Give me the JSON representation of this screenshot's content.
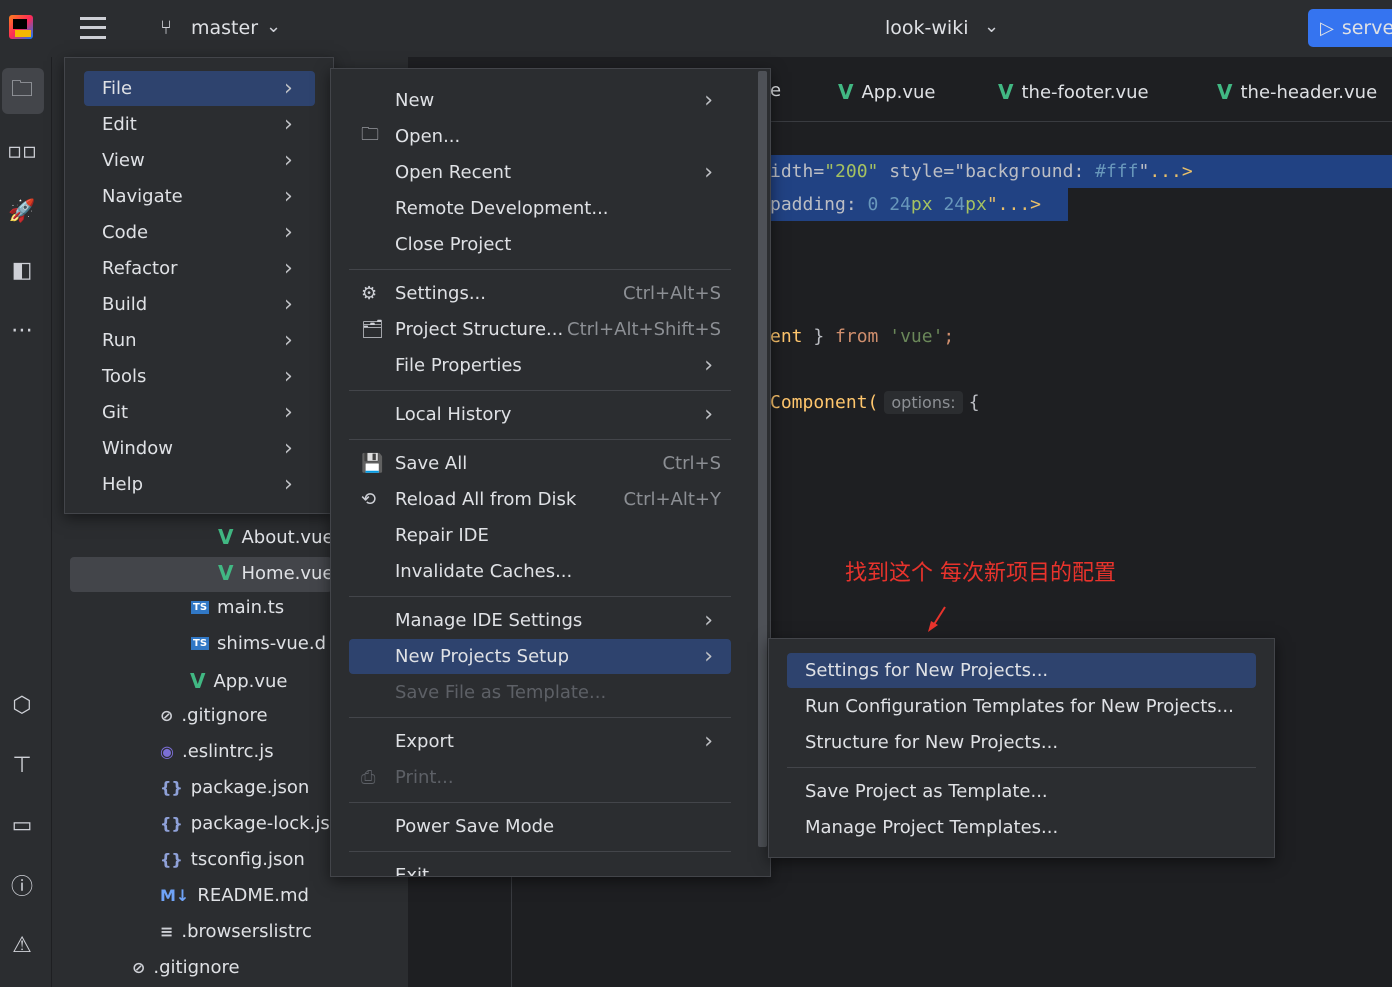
{
  "topbar": {
    "branch": "master",
    "project": "look-wiki",
    "run_label": "serve"
  },
  "tabs": [
    "e",
    "App.vue",
    "the-footer.vue",
    "the-header.vue"
  ],
  "code": {
    "line1": [
      {
        "t": "idth=",
        "c": "#bcbec4"
      },
      {
        "t": "\"200\"",
        "c": "#a5c261"
      },
      {
        "t": " style=",
        "c": "#bcbec4"
      },
      {
        "t": "\"background: ",
        "c": "#bcbec4"
      },
      {
        "t": "#fff",
        "c": "#6897bb"
      },
      {
        "t": "\"",
        "c": "#bcbec4"
      },
      {
        "t": "...>",
        "c": "#e8bf6a"
      }
    ],
    "line2": [
      {
        "t": "padding: ",
        "c": "#bcbec4"
      },
      {
        "t": "0 ",
        "c": "#6897bb"
      },
      {
        "t": "24",
        "c": "#6897bb"
      },
      {
        "t": "px ",
        "c": "#a5c261"
      },
      {
        "t": "24",
        "c": "#6897bb"
      },
      {
        "t": "px",
        "c": "#a5c261"
      },
      {
        "t": "\"...>",
        "c": "#e8bf6a"
      }
    ],
    "line3": [
      {
        "t": "ent",
        "c": "#ffc66d"
      },
      {
        "t": " } ",
        "c": "#bcbec4"
      },
      {
        "t": "from",
        "c": "#cf8e6d"
      },
      {
        "t": " 'vue'",
        "c": "#6a8759"
      },
      {
        "t": ";",
        "c": "#cf8e6d"
      }
    ],
    "line4_pre": "Component(",
    "line4_hint": "options:",
    "line4_post": "{"
  },
  "main_menu": [
    {
      "label": "File",
      "selected": true
    },
    {
      "label": "Edit"
    },
    {
      "label": "View"
    },
    {
      "label": "Navigate"
    },
    {
      "label": "Code"
    },
    {
      "label": "Refactor"
    },
    {
      "label": "Build"
    },
    {
      "label": "Run"
    },
    {
      "label": "Tools"
    },
    {
      "label": "Git"
    },
    {
      "label": "Window"
    },
    {
      "label": "Help"
    }
  ],
  "file_menu": [
    {
      "label": "New",
      "submenu": true
    },
    {
      "label": "Open...",
      "icon": "folder-icon"
    },
    {
      "label": "Open Recent",
      "submenu": true
    },
    {
      "label": "Remote Development..."
    },
    {
      "label": "Close Project"
    },
    {
      "sep": true
    },
    {
      "label": "Settings...",
      "icon": "gear-icon",
      "shortcut": "Ctrl+Alt+S"
    },
    {
      "label": "Project Structure...",
      "icon": "project-structure-icon",
      "shortcut": "Ctrl+Alt+Shift+S"
    },
    {
      "label": "File Properties",
      "submenu": true
    },
    {
      "sep": true
    },
    {
      "label": "Local History",
      "submenu": true
    },
    {
      "sep": true
    },
    {
      "label": "Save All",
      "icon": "save-icon",
      "shortcut": "Ctrl+S"
    },
    {
      "label": "Reload All from Disk",
      "icon": "reload-icon",
      "shortcut": "Ctrl+Alt+Y"
    },
    {
      "label": "Repair IDE"
    },
    {
      "label": "Invalidate Caches..."
    },
    {
      "sep": true
    },
    {
      "label": "Manage IDE Settings",
      "submenu": true
    },
    {
      "label": "New Projects Setup",
      "submenu": true,
      "selected": true
    },
    {
      "label": "Save File as Template...",
      "disabled": true
    },
    {
      "sep": true
    },
    {
      "label": "Export",
      "submenu": true
    },
    {
      "label": "Print...",
      "icon": "print-icon",
      "disabled": true
    },
    {
      "sep": true
    },
    {
      "label": "Power Save Mode"
    },
    {
      "sep": true
    },
    {
      "label": "Exit"
    }
  ],
  "sub_menu": [
    {
      "label": "Settings for New Projects...",
      "selected": true
    },
    {
      "label": "Run Configuration Templates for New Projects..."
    },
    {
      "label": "Structure for New Projects..."
    },
    {
      "sep": true
    },
    {
      "label": "Save Project as Template..."
    },
    {
      "label": "Manage Project Templates..."
    }
  ],
  "annotation": {
    "text": "找到这个 每次新项目的配置",
    "color": "#e8332c"
  },
  "tree": [
    {
      "name": "About.vue",
      "icon": "vue"
    },
    {
      "name": "Home.vue",
      "icon": "vue",
      "selected": true
    },
    {
      "name": "main.ts",
      "icon": "ts"
    },
    {
      "name": "shims-vue.d",
      "icon": "ts"
    },
    {
      "name": "App.vue",
      "icon": "vue"
    },
    {
      "name": ".gitignore",
      "icon": "ignore"
    },
    {
      "name": ".eslintrc.js",
      "icon": "eslint"
    },
    {
      "name": "package.json",
      "icon": "json"
    },
    {
      "name": "package-lock.js",
      "icon": "json"
    },
    {
      "name": "tsconfig.json",
      "icon": "json"
    },
    {
      "name": "README.md",
      "icon": "md"
    },
    {
      "name": ".browserslistrc",
      "icon": "text"
    },
    {
      "name": ".gitignore",
      "icon": "ignore"
    }
  ],
  "colors": {
    "accent": "#3574f0",
    "selection": "#2e436e",
    "vue": "#41b883"
  }
}
